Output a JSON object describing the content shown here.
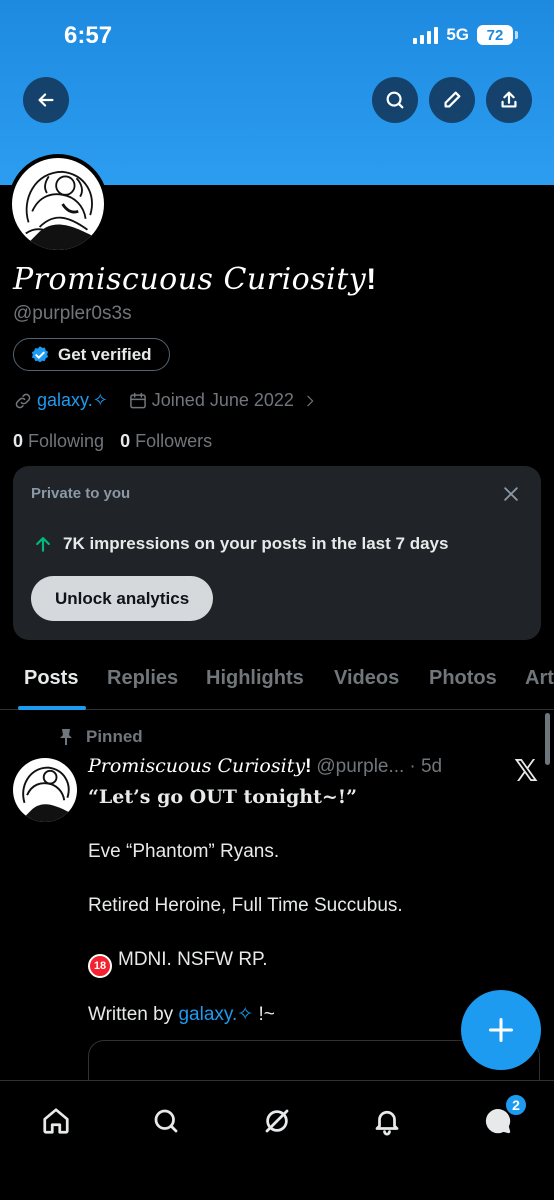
{
  "status_bar": {
    "time": "6:57",
    "network": "5G",
    "battery": "72"
  },
  "header": {
    "back_icon": "arrow-left-icon",
    "search_icon": "search-icon",
    "edit_icon": "pencil-icon",
    "share_icon": "share-icon",
    "banner_color": "#2c9df0"
  },
  "profile": {
    "name": "𝑃𝑟𝑜𝑚𝑖𝑠𝑐𝑢𝑜𝑢𝑠 𝐶𝑢𝑟𝑖𝑜𝑠𝑖𝑡𝑦",
    "name_suffix": "!",
    "handle": "@purpler0s3s",
    "verify_label": "Get verified",
    "link_label": "galaxy.✧",
    "joined": "Joined June 2022",
    "following_count": "0",
    "following_label": "Following",
    "followers_count": "0",
    "followers_label": "Followers"
  },
  "private_card": {
    "title": "Private to you",
    "impressions_text": "7K impressions on your posts in the last 7 days",
    "unlock_label": "Unlock analytics"
  },
  "tabs": [
    "Posts",
    "Replies",
    "Highlights",
    "Videos",
    "Photos",
    "Art"
  ],
  "post": {
    "pinned_label": "Pinned",
    "author_name": "𝑃𝑟𝑜𝑚𝑖𝑠𝑐𝑢𝑜𝑢𝑠 𝐶𝑢𝑟𝑖𝑜𝑠𝑖𝑡𝑦",
    "author_suffix": "!",
    "author_handle": "@purple...",
    "time": "· 5d",
    "quote_line": "“Let’s go OUT tonight~!”",
    "line1": "Eve “Phantom” Ryans.",
    "line2": "Retired Heroine, Full Time Succubus.",
    "line3_badge": "18",
    "line3": "MDNI. NSFW RP.",
    "line4_prefix": "Written by",
    "line4_link": "galaxy.✧",
    "line4_suffix": "!~"
  },
  "bottom_nav": {
    "items": [
      "home-icon",
      "search-icon",
      "grok-icon",
      "notifications-icon",
      "messages-icon"
    ],
    "messages_badge": "2"
  },
  "colors": {
    "accent": "#1d9bf0",
    "background": "#000000",
    "card": "#202327",
    "muted": "#71767b"
  }
}
